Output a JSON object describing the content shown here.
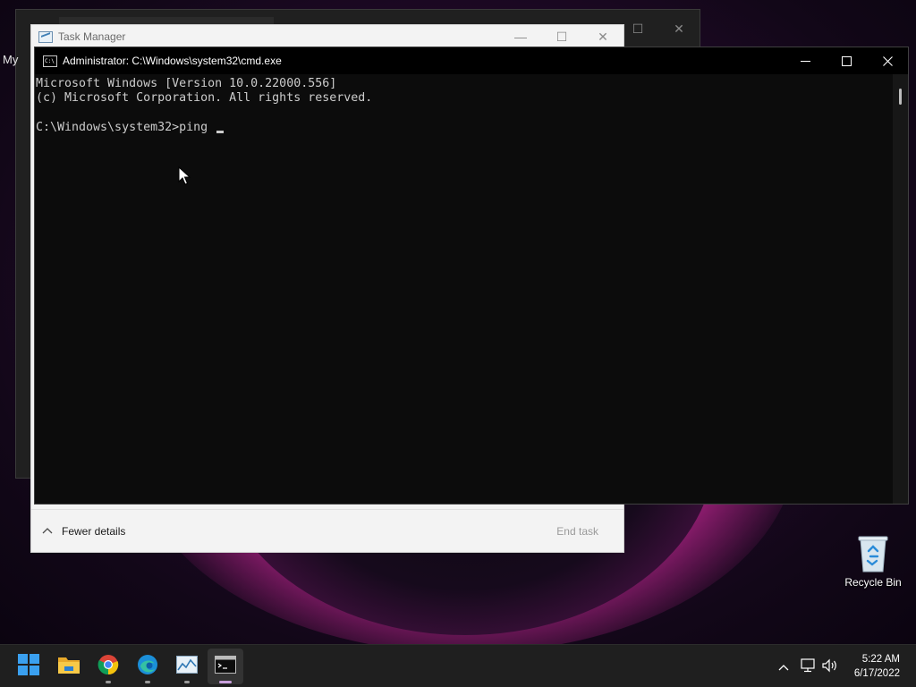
{
  "desktop": {
    "recycle_bin_label": "Recycle Bin",
    "bg_window_partial_text": "My"
  },
  "task_manager": {
    "title": "Task Manager",
    "fewer_details_label": "Fewer details",
    "end_task_label": "End task"
  },
  "cmd": {
    "title": "Administrator: C:\\Windows\\system32\\cmd.exe",
    "icon_text": "C:\\",
    "lines": [
      "Microsoft Windows [Version 10.0.22000.556]",
      "(c) Microsoft Corporation. All rights reserved.",
      "",
      "C:\\Windows\\system32>ping "
    ]
  },
  "taskbar": {
    "items": [
      "start-icon",
      "file-explorer-icon",
      "chrome-icon",
      "edge-icon",
      "task-manager-icon",
      "terminal-icon"
    ],
    "active_item": "terminal-icon",
    "tray_icons": [
      "chevron-up-icon",
      "network-icon",
      "volume-icon"
    ],
    "time": "5:22 AM",
    "date": "6/17/2022"
  },
  "colors": {
    "cmd_background": "#0c0c0c",
    "cmd_text": "#cccccc",
    "taskbar": "#1f1f1f",
    "windows_blue": "#0078d4"
  }
}
